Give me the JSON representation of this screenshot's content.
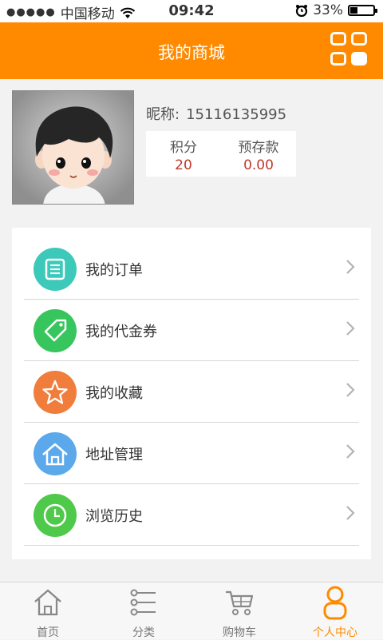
{
  "status_bar": {
    "carrier": "中国移动",
    "time": "09:42",
    "battery_percent": "33%",
    "battery_level": 0.33
  },
  "header": {
    "title": "我的商城",
    "grid_icon": "grid-menu-icon"
  },
  "profile": {
    "nickname_label": "昵称:",
    "nickname_value": "15116135995",
    "points_label": "积分",
    "points_value": "20",
    "deposit_label": "预存款",
    "deposit_value": "0.00"
  },
  "menu": {
    "items": [
      {
        "label": "我的订单",
        "icon": "order-icon",
        "color": "#3dc9b9"
      },
      {
        "label": "我的代金券",
        "icon": "coupon-tag-icon",
        "color": "#37c55d"
      },
      {
        "label": "我的收藏",
        "icon": "star-icon",
        "color": "#f07d3c"
      },
      {
        "label": "地址管理",
        "icon": "house-icon",
        "color": "#5ba8ea"
      },
      {
        "label": "浏览历史",
        "icon": "clock-icon",
        "color": "#4ec94a"
      }
    ]
  },
  "tabbar": {
    "tabs": [
      {
        "label": "首页",
        "icon": "home-icon"
      },
      {
        "label": "分类",
        "icon": "category-list-icon"
      },
      {
        "label": "购物车",
        "icon": "cart-icon"
      },
      {
        "label": "个人中心",
        "icon": "person-icon",
        "active": true
      }
    ]
  },
  "colors": {
    "brand": "#ff8a00",
    "price": "#c0392b"
  }
}
